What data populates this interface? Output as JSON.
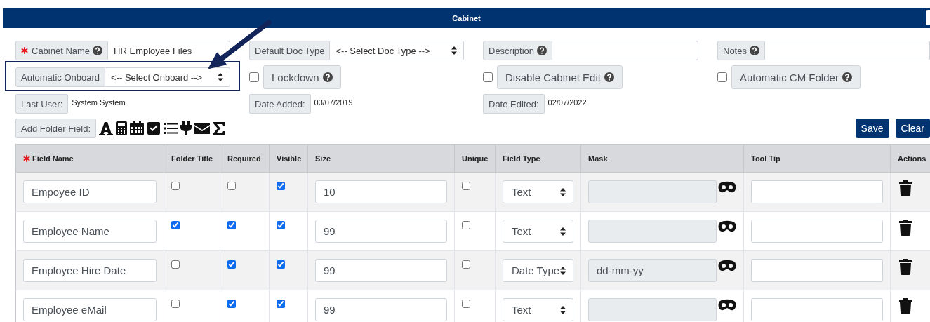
{
  "header": {
    "title": "Cabinet"
  },
  "form": {
    "fields": [
      {
        "kind": "text",
        "label": "Cabinet Name",
        "required": true,
        "help": true,
        "value": "HR Employee Files"
      },
      {
        "kind": "select",
        "label": "Default Doc Type",
        "required": false,
        "help": false,
        "value": "<-- Select Doc Type -->"
      },
      {
        "kind": "text",
        "label": "Description",
        "required": false,
        "help": true
      },
      {
        "kind": "text",
        "label": "Notes",
        "required": false,
        "help": true
      }
    ],
    "onboard": {
      "label": "Automatic Onboard",
      "value": "<-- Select Onboard -->",
      "highlighted": true
    },
    "toggles": [
      {
        "label": "Lockdown",
        "checked": false,
        "help": true
      },
      {
        "label": "Disable Cabinet Edit",
        "checked": false,
        "help": true
      },
      {
        "label": "Automatic CM Folder",
        "checked": false,
        "help": true
      }
    ],
    "info": [
      {
        "label": "Last User:",
        "value": "System System"
      },
      {
        "label": "Date Added:",
        "value": "03/07/2019"
      },
      {
        "label": "Date Edited:",
        "value": "02/07/2022"
      }
    ],
    "add_folder_field": {
      "label": "Add Folder Field:"
    },
    "buttons": [
      {
        "label": "Save"
      },
      {
        "label": "Clear"
      }
    ]
  },
  "table": {
    "columns": [
      {
        "label": "Field Name",
        "required": true
      },
      {
        "label": "Folder Title",
        "required": false
      },
      {
        "label": "Required",
        "required": false
      },
      {
        "label": "Visible",
        "required": false
      },
      {
        "label": "Size",
        "required": false
      },
      {
        "label": "Unique",
        "required": false
      },
      {
        "label": "Field Type",
        "required": false
      },
      {
        "label": "Mask",
        "required": false
      },
      {
        "label": "Tool Tip",
        "required": false
      },
      {
        "label": "Actions",
        "required": false
      }
    ],
    "rows": [
      {
        "field_name": "Empoyee ID",
        "folder_title": false,
        "required": false,
        "visible": true,
        "size": "10",
        "unique": false,
        "field_type": "Text"
      },
      {
        "field_name": "Employee Name",
        "folder_title": true,
        "required": true,
        "visible": true,
        "size": "99",
        "unique": false,
        "field_type": "Text"
      },
      {
        "field_name": "Employee Hire Date",
        "folder_title": false,
        "required": true,
        "visible": true,
        "size": "99",
        "unique": false,
        "field_type": "Date Type",
        "mask": "dd-mm-yy"
      },
      {
        "field_name": "Employee eMail",
        "folder_title": false,
        "required": true,
        "visible": true,
        "size": "99",
        "unique": false,
        "field_type": "Text"
      }
    ]
  }
}
